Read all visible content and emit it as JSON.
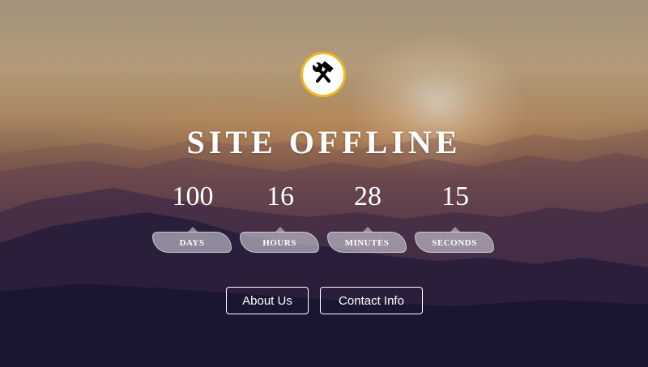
{
  "page": {
    "title": "SITE OFFLINE",
    "logo_icon": "tools-icon",
    "accent_color": "#f2b81d"
  },
  "countdown": [
    {
      "value": "100",
      "label": "DAYS"
    },
    {
      "value": "16",
      "label": "HOURS"
    },
    {
      "value": "28",
      "label": "MINUTES"
    },
    {
      "value": "15",
      "label": "SECONDS"
    }
  ],
  "buttons": {
    "about": "About Us",
    "contact": "Contact Info"
  }
}
